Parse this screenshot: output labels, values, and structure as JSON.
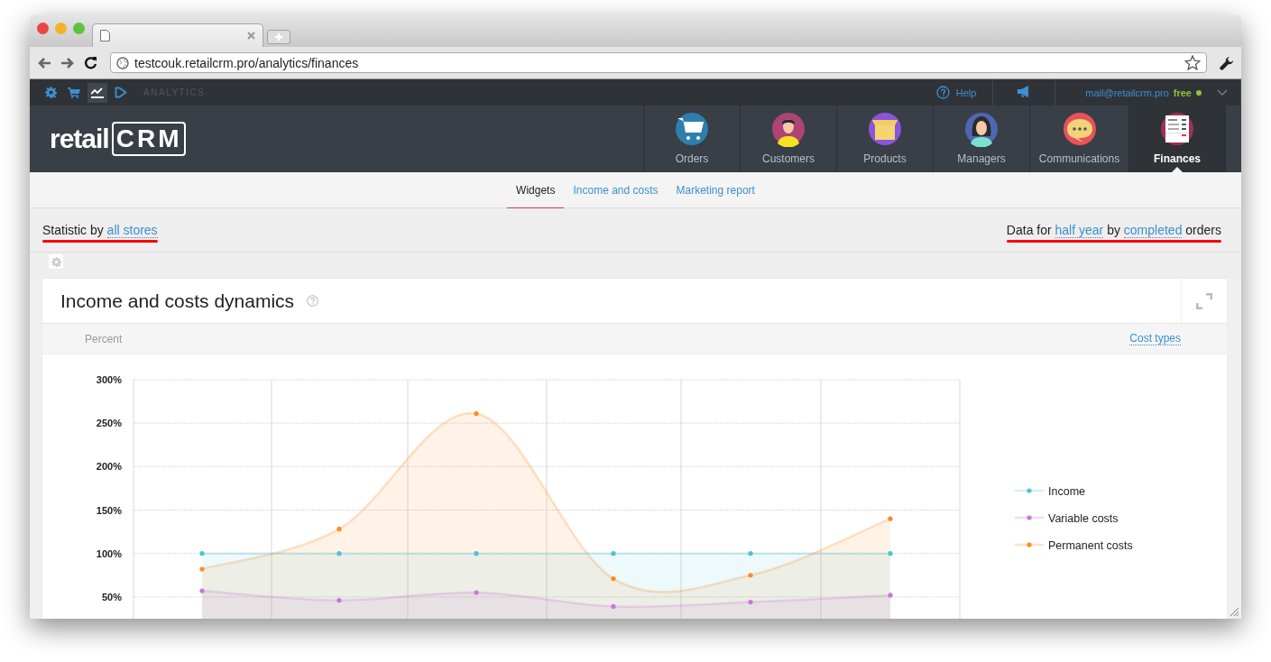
{
  "browser": {
    "address": "testcouk.retailcrm.pro/analytics/finances"
  },
  "topbar": {
    "icons": [
      {
        "kind": "settings",
        "selected": false
      },
      {
        "kind": "cart",
        "selected": false
      },
      {
        "kind": "analytics",
        "selected": true
      },
      {
        "kind": "play",
        "selected": false
      }
    ],
    "section": "ANALYTICS",
    "help": "Help",
    "user_email": "mail@retailcrm.pro",
    "plan": "free"
  },
  "logo": {
    "text": "retail",
    "mark": "CRM"
  },
  "modules": [
    {
      "label": "Orders",
      "kind": "orders",
      "selected": false
    },
    {
      "label": "Customers",
      "kind": "customers",
      "selected": false
    },
    {
      "label": "Products",
      "kind": "products",
      "selected": false
    },
    {
      "label": "Managers",
      "kind": "managers",
      "selected": false
    },
    {
      "label": "Communications",
      "kind": "communications",
      "selected": false
    },
    {
      "label": "Finances",
      "kind": "finances",
      "selected": true
    }
  ],
  "subnav": [
    {
      "label": "Widgets",
      "selected": true
    },
    {
      "label": "Income and costs",
      "selected": false
    },
    {
      "label": "Marketing report",
      "selected": false
    }
  ],
  "filters": {
    "statistic": {
      "prefix": "Statistic by",
      "store_link": "all stores",
      "annotated": true
    },
    "period": {
      "prefix": "Data for",
      "period_link": "half year",
      "middle": "by",
      "status_link": "completed",
      "suffix": "orders",
      "annotated": true
    }
  },
  "widget": {
    "title": "Income and costs dynamics",
    "unit": "Percent",
    "cost_types": "Cost types",
    "chart_data": {
      "type": "area",
      "ylim": [
        0,
        300
      ],
      "grid": true,
      "legend": true,
      "yticks": [
        {
          "value": 50,
          "label": "50%"
        },
        {
          "value": 100,
          "label": "100%"
        },
        {
          "value": 150,
          "label": "150%"
        },
        {
          "value": 200,
          "label": "200%"
        },
        {
          "value": 250,
          "label": "250%"
        },
        {
          "value": 300,
          "label": "300%"
        }
      ],
      "series": [
        {
          "name": "Income",
          "color": "#4ec3d3",
          "values": [
            100,
            100,
            100,
            100,
            100,
            100
          ]
        },
        {
          "name": "Variable costs",
          "color": "#c579d6",
          "values": [
            57,
            46,
            55,
            39,
            44,
            52
          ]
        },
        {
          "name": "Permanent costs",
          "color": "#ff8c1a",
          "values": [
            82,
            128,
            261,
            71,
            75,
            140
          ]
        }
      ]
    }
  }
}
